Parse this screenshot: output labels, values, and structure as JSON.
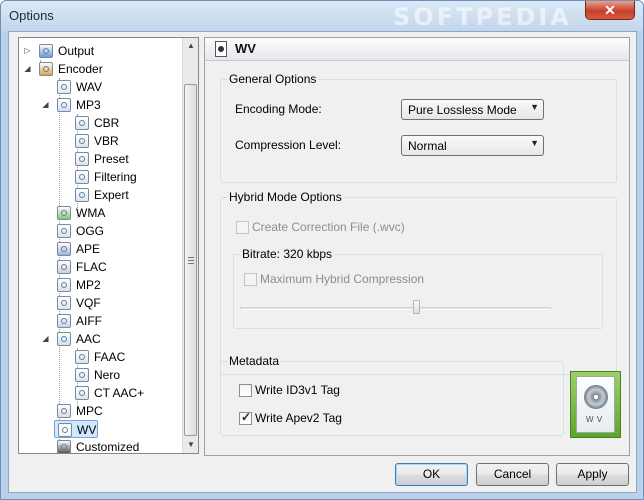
{
  "window": {
    "title": "Options",
    "watermark": "SOFTPEDIA",
    "close_glyph": "✕"
  },
  "tree": {
    "items": [
      {
        "label": "Output",
        "icon": "output-arrow-icon",
        "expander": "▷"
      },
      {
        "label": "Encoder",
        "icon": "encoder-tools-icon",
        "expander": "◢"
      },
      {
        "label": "WAV",
        "icon": "wav-file-icon"
      },
      {
        "label": "MP3",
        "icon": "mp3-file-icon",
        "expander": "◢"
      },
      {
        "label": "CBR",
        "icon": "cbr-settings-icon"
      },
      {
        "label": "VBR",
        "icon": "vbr-settings-icon"
      },
      {
        "label": "Preset",
        "icon": "preset-settings-icon"
      },
      {
        "label": "Filtering",
        "icon": "filtering-settings-icon"
      },
      {
        "label": "Expert",
        "icon": "expert-settings-icon"
      },
      {
        "label": "WMA",
        "icon": "wma-file-icon"
      },
      {
        "label": "OGG",
        "icon": "ogg-file-icon"
      },
      {
        "label": "APE",
        "icon": "ape-file-icon"
      },
      {
        "label": "FLAC",
        "icon": "flac-file-icon"
      },
      {
        "label": "MP2",
        "icon": "mp2-file-icon"
      },
      {
        "label": "VQF",
        "icon": "vqf-file-icon"
      },
      {
        "label": "AIFF",
        "icon": "aiff-file-icon"
      },
      {
        "label": "AAC",
        "icon": "aac-file-icon",
        "expander": "◢"
      },
      {
        "label": "FAAC",
        "icon": "faac-settings-icon"
      },
      {
        "label": "Nero",
        "icon": "nero-settings-icon"
      },
      {
        "label": "CT AAC+",
        "icon": "ct-aac-settings-icon"
      },
      {
        "label": "MPC",
        "icon": "mpc-file-icon"
      },
      {
        "label": "WV",
        "icon": "wv-file-icon",
        "selected": true
      },
      {
        "label": "Customized",
        "icon": "customized-icon"
      }
    ],
    "scroll_up": "▲",
    "scroll_down": "▼"
  },
  "panel": {
    "title": "WV",
    "general": {
      "title": "General Options",
      "encoding_mode_label": "Encoding Mode:",
      "encoding_mode_value": "Pure Lossless Mode",
      "compression_level_label": "Compression Level:",
      "compression_level_value": "Normal",
      "dropdown_arrow": "▼"
    },
    "hybrid": {
      "title": "Hybrid Mode Options",
      "create_correction_label": "Create Correction File (.wvc)",
      "create_correction_checked": false,
      "bitrate_title": "Bitrate: 320 kbps",
      "max_hybrid_label": "Maximum Hybrid Compression",
      "max_hybrid_checked": false
    },
    "metadata": {
      "title": "Metadata",
      "id3v1_label": "Write ID3v1 Tag",
      "id3v1_checked": false,
      "apev2_label": "Write Apev2 Tag",
      "apev2_checked": true,
      "check_glyph": "✓"
    },
    "logo_text": "WV"
  },
  "buttons": {
    "ok": "OK",
    "cancel": "Cancel",
    "apply": "Apply"
  }
}
